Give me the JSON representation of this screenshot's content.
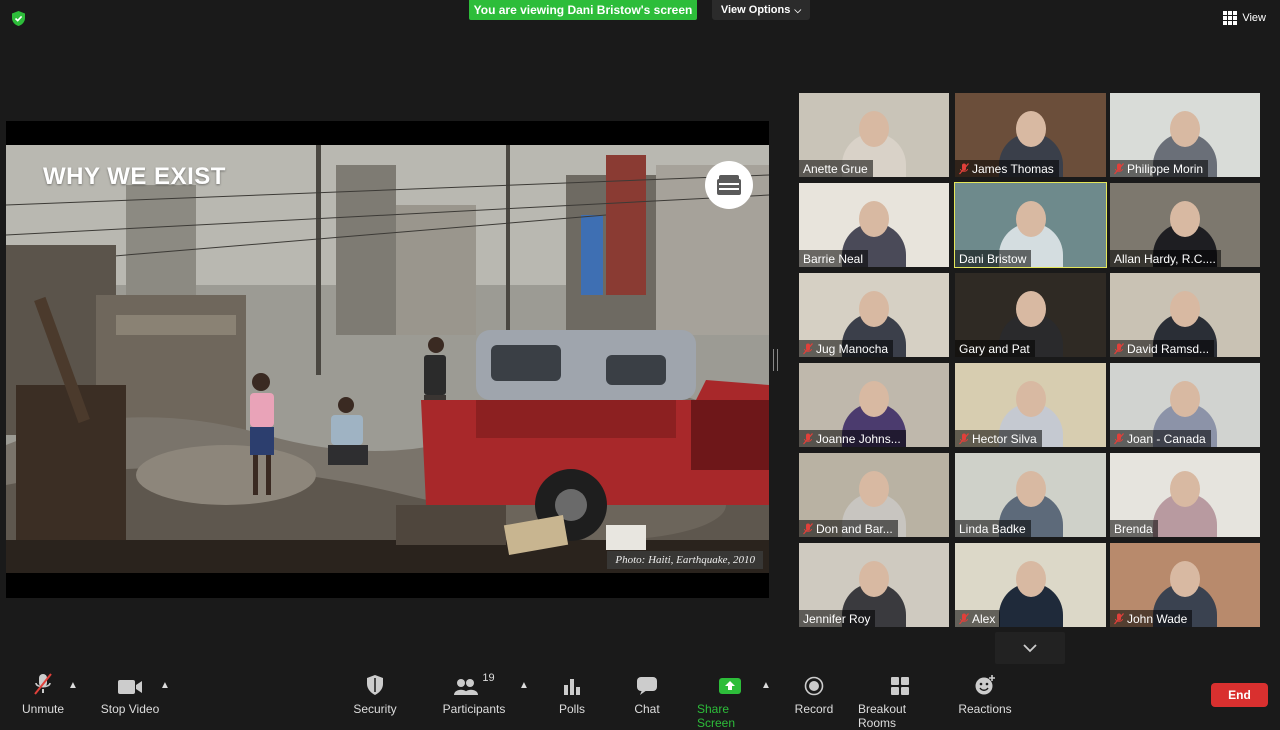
{
  "top_bar": {
    "share_banner": "You are viewing Dani Bristow's screen",
    "view_options": "View Options",
    "view": "View"
  },
  "slide": {
    "title": "WHY WE EXIST",
    "caption": "Photo: Haiti, Earthquake, 2010"
  },
  "participants": [
    {
      "name": "Anette Grue",
      "muted": false,
      "active": false
    },
    {
      "name": "James Thomas",
      "muted": true,
      "active": false
    },
    {
      "name": "Philippe Morin",
      "muted": true,
      "active": false
    },
    {
      "name": "Barrie Neal",
      "muted": false,
      "active": false
    },
    {
      "name": "Dani Bristow",
      "muted": false,
      "active": true
    },
    {
      "name": "Allan Hardy, R.C....",
      "muted": false,
      "active": false
    },
    {
      "name": "Jug Manocha",
      "muted": true,
      "active": false
    },
    {
      "name": "Gary and Pat",
      "muted": false,
      "active": false
    },
    {
      "name": "David Ramsd...",
      "muted": true,
      "active": false
    },
    {
      "name": "Joanne Johns...",
      "muted": true,
      "active": false
    },
    {
      "name": "Hector Silva",
      "muted": true,
      "active": false
    },
    {
      "name": "Joan - Canada",
      "muted": true,
      "active": false
    },
    {
      "name": "Don and Bar...",
      "muted": true,
      "active": false
    },
    {
      "name": "Linda Badke",
      "muted": false,
      "active": false
    },
    {
      "name": "Brenda",
      "muted": false,
      "active": false
    },
    {
      "name": "Jennifer Roy",
      "muted": false,
      "active": false
    },
    {
      "name": "Alex",
      "muted": true,
      "active": false
    },
    {
      "name": "John Wade",
      "muted": true,
      "active": false
    }
  ],
  "toolbar": {
    "unmute": "Unmute",
    "stop_video": "Stop Video",
    "security": "Security",
    "participants": "Participants",
    "participants_count": "19",
    "polls": "Polls",
    "chat": "Chat",
    "share_screen": "Share Screen",
    "record": "Record",
    "breakout_rooms": "Breakout Rooms",
    "reactions": "Reactions",
    "end": "End"
  },
  "colors": {
    "share_green": "#2dbd3a",
    "active_speaker": "#e4e65a",
    "end_red": "#d9302f",
    "muted_red": "#e0403a"
  }
}
